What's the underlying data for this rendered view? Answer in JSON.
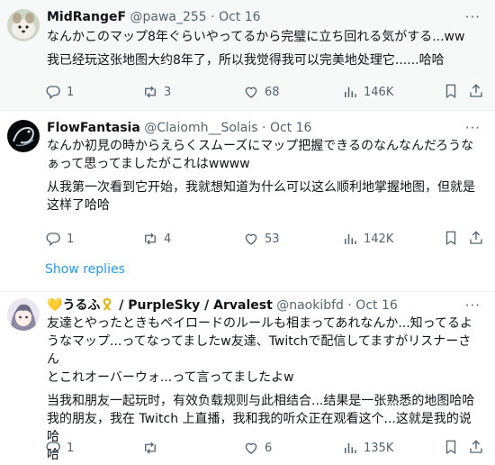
{
  "tweets": [
    {
      "name": "MidRangeF",
      "handle": "@pawa_255",
      "date": "Oct 16",
      "text": [
        "なんかこのマップ8年ぐらいやってるから完璧に立ち回れる気がする...ww",
        "我已经玩这张地图大约8年了，所以我觉得我可以完美地处理它......哈哈"
      ],
      "replies": "1",
      "reposts": "3",
      "likes": "68",
      "views": "146K"
    },
    {
      "name": "FlowFantasia",
      "handle": "@Claiomh__Solais",
      "date": "Oct 16",
      "text": [
        "なんか初見の時からえらくスムーズにマップ把握できるのなんなんだろうな",
        "ぁって思ってましたがこれはwwww",
        "从我第一次看到它开始，我就想知道为什么可以这么顺利地掌握地图，但就是",
        "这样了哈哈"
      ],
      "replies": "1",
      "reposts": "4",
      "likes": "53",
      "views": "142K",
      "show_replies": "Show replies"
    },
    {
      "name_emoji_prefix": "💛",
      "name_main": "うるふ",
      "name_rest": " / PurpleSky / Arvalest",
      "handle": "@naokibfd",
      "date": "Oct 16",
      "text": [
        "友達とやったときもペイロードのルールも相まってあれなんか...知ってるよ",
        "うなマップ...ってなってましたw友達、Twitchで配信してますがリスナーさん",
        "とこれオーバーウォ...って言ってましたよw",
        "当我和朋友一起玩时，有效负载规则与此相结合...结果是一张熟悉的地图哈哈",
        "我的朋友，我在 Twitch 上直播，我和我的听众正在观看这个...这就是我的说哈",
        "哈"
      ],
      "replies": "1",
      "reposts": "",
      "likes": "6",
      "views": "135K"
    }
  ],
  "icons": {
    "reply": "reply-icon",
    "repost": "repost-icon",
    "like": "heart-icon",
    "views": "views-icon",
    "bookmark": "bookmark-icon",
    "share": "share-icon",
    "more": "more-icon"
  },
  "colors": {
    "accent": "#1d9bf0",
    "muted": "#536471",
    "text": "#0f1419"
  }
}
